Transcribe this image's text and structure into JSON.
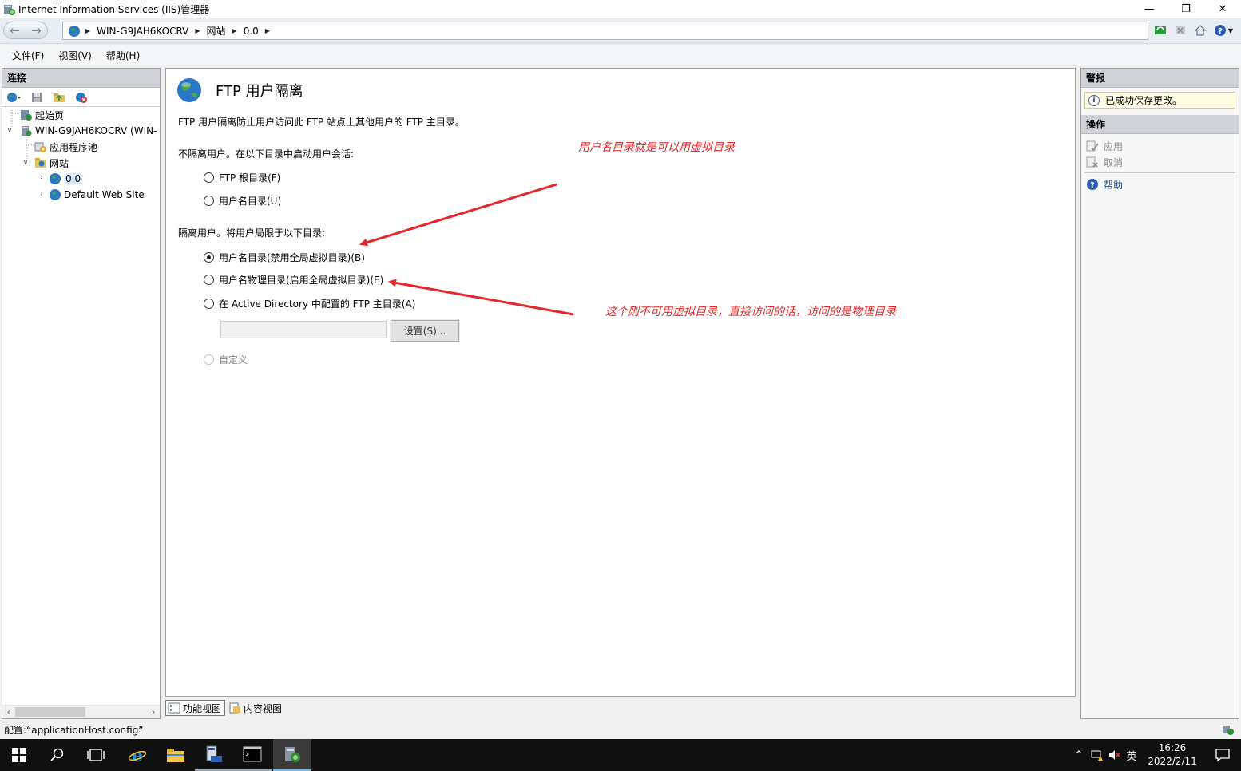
{
  "window": {
    "title": "Internet Information Services (IIS)管理器",
    "minimize": "—",
    "maximize": "❐",
    "close": "✕"
  },
  "addressbar": {
    "segments": [
      "WIN-G9JAH6KOCRV",
      "网站",
      "0.0"
    ]
  },
  "menu": {
    "items": [
      "文件(F)",
      "视图(V)",
      "帮助(H)"
    ]
  },
  "connections": {
    "header": "连接",
    "tree": {
      "start_page": "起始页",
      "server": "WIN-G9JAH6KOCRV (WIN-",
      "app_pools": "应用程序池",
      "sites": "网站",
      "site_00": "0.0",
      "default_site": "Default Web Site"
    }
  },
  "main": {
    "title": "FTP 用户隔离",
    "description": "FTP 用户隔离防止用户访问此 FTP 站点上其他用户的 FTP 主目录。",
    "no_isolate_header": "不隔离用户。在以下目录中启动用户会话:",
    "opt_ftp_root": "FTP 根目录(F)",
    "opt_username_dir": "用户名目录(U)",
    "isolate_header": "隔离用户。将用户局限于以下目录:",
    "opt_username_dir_disable_global": "用户名目录(禁用全局虚拟目录)(B)",
    "opt_username_physical": "用户名物理目录(启用全局虚拟目录)(E)",
    "opt_active_directory": "在 Active Directory 中配置的 FTP 主目录(A)",
    "settings_button": "设置(S)...",
    "opt_custom": "自定义"
  },
  "annotations": {
    "note1": "用户名目录就是可以用虚拟目录",
    "note2": "这个则不可用虚拟目录，直接访问的话，访问的是物理目录",
    "color": "#e8262a"
  },
  "view_tabs": {
    "features": "功能视图",
    "content": "内容视图"
  },
  "alerts": {
    "header": "警报",
    "message": "已成功保存更改。"
  },
  "actions": {
    "header": "操作",
    "apply": "应用",
    "cancel": "取消",
    "help": "帮助"
  },
  "status": {
    "text": "配置:“applicationHost.config”"
  },
  "taskbar": {
    "ime": "英",
    "time": "16:26",
    "date": "2022/2/11"
  }
}
